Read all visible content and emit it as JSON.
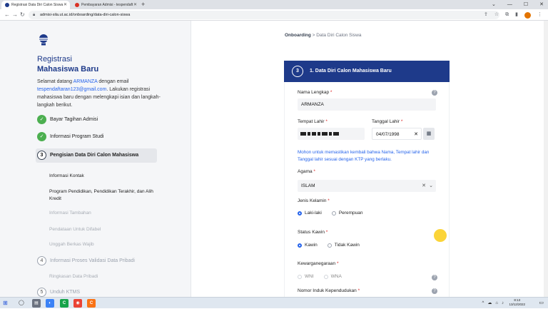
{
  "browser": {
    "tabs": [
      {
        "title": "Registrasi Data Diri Calon Siswa",
        "active": true
      },
      {
        "title": "Pembayaran Admisi - tespendaft",
        "active": false
      }
    ],
    "new_tab": "+",
    "url": "admisi-sila.ut.ac.id/onboarding/data-diri-calon-siswa"
  },
  "sidebar": {
    "title": "Registrasi",
    "subtitle": "Mahasiswa Baru",
    "welcome_prefix": "Selamat datang",
    "user_name": "ARMANZA",
    "welcome_mid": "dengan email",
    "email": "tespendaftaran123@gmail.com",
    "welcome_suffix": ". Lakukan registrasi mahasiswa baru dengan melengkapi isian dan langkah-langkah berikut.",
    "steps": [
      {
        "label": "Bayar Tagihan Admisi",
        "icon": "check",
        "state": "done"
      },
      {
        "label": "Informasi Program Studi",
        "icon": "check",
        "state": "done"
      },
      {
        "label": "Pengisian Data Diri Calon Mahasiswa",
        "icon": "3",
        "state": "active"
      }
    ],
    "substeps": [
      {
        "label": "Informasi Kontak",
        "state": "normal"
      },
      {
        "label": "Program Pendidikan, Pendidikan Terakhir, dan Alih Kredit",
        "state": "normal"
      },
      {
        "label": "Informasi Tambahan",
        "state": "muted"
      },
      {
        "label": "Pendataan Untuk Difabel",
        "state": "muted"
      },
      {
        "label": "Unggah Berkas Wajib",
        "state": "muted"
      }
    ],
    "later_steps": [
      {
        "label": "Informasi Proses Validasi Data Pribadi",
        "icon": "4"
      },
      {
        "label": "Ringkasan Data Pribadi",
        "icon": ""
      },
      {
        "label": "Unduh KTMS",
        "icon": "5"
      }
    ]
  },
  "main": {
    "breadcrumb_root": "Onboarding",
    "breadcrumb_sep": ">",
    "breadcrumb_current": "Data Diri Calon Siswa",
    "section_number": "3",
    "section_title": "1. Data Diri Calon Mahasiswa Baru",
    "fields": {
      "nama_label": "Nama Lengkap",
      "nama_value": "ARMANZA",
      "tempat_label": "Tempat Lahir",
      "tanggal_label": "Tanggal Lahir",
      "tanggal_value": "04/07/1998",
      "note": "Mohon untuk memastikan kembali bahwa Nama, Tempat lahir dan Tanggal lahir sesuai dengan KTP yang berlaku.",
      "agama_label": "Agama",
      "agama_value": "ISLAM",
      "jenis_kelamin_label": "Jenis Kelamin",
      "jenis_kelamin_options": [
        "Laki-laki",
        "Perempuan"
      ],
      "jenis_kelamin_selected": "Laki-laki",
      "status_kawin_label": "Status Kawin",
      "status_kawin_options": [
        "Kawin",
        "Tidak Kawin"
      ],
      "status_kawin_selected": "Kawin",
      "kewarganegaraan_label": "Kewarganegaraan",
      "kewarganegaraan_options": [
        "WNI",
        "WNA"
      ],
      "nik_label": "Nomor Induk Kependudukan"
    },
    "required_mark": "*",
    "help_glyph": "?"
  },
  "taskbar": {
    "clock_time": "8:13",
    "clock_date": "13/12/2022"
  },
  "colors": {
    "primary": "#1e3a8a",
    "link": "#2563eb",
    "success": "#4caf50",
    "required": "#dc2626",
    "cursor_highlight": "#facc15"
  }
}
